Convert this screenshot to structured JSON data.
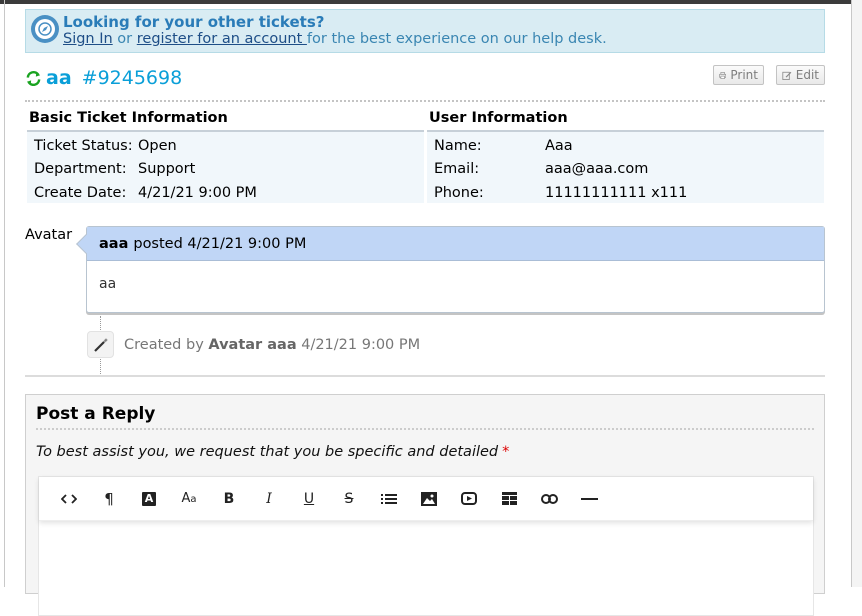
{
  "notice": {
    "title": "Looking for your other tickets?",
    "sign_in": "Sign In",
    "or_text": " or ",
    "register": "register for an account ",
    "rest": "for the best experience on our help desk."
  },
  "ticket": {
    "subject": "aa",
    "number": "#9245698",
    "print_label": "Print",
    "edit_label": "Edit"
  },
  "basic_info": {
    "heading": "Basic Ticket Information",
    "rows": [
      {
        "label": "Ticket Status:",
        "value": "Open"
      },
      {
        "label": "Department:",
        "value": "Support"
      },
      {
        "label": "Create Date:",
        "value": "4/21/21 9:00 PM"
      }
    ]
  },
  "user_info": {
    "heading": "User Information",
    "rows": [
      {
        "label": "Name:",
        "value": "Aaa"
      },
      {
        "label": "Email:",
        "value": "aaa@aaa.com"
      },
      {
        "label": "Phone:",
        "value": "11111111111 x111"
      }
    ]
  },
  "thread": {
    "avatar_label": "Avatar",
    "post": {
      "author": "aaa",
      "posted_text": "posted 4/21/21 9:00 PM",
      "body": "aa"
    },
    "event": {
      "prefix": "Created by ",
      "who": "Avatar aaa",
      "when": " 4/21/21 9:00 PM"
    }
  },
  "reply": {
    "title": "Post a Reply",
    "note": "To best assist you, we request that you be specific and detailed",
    "required_mark": "*",
    "toolbar": [
      {
        "name": "html-source-button",
        "glyph": "<>"
      },
      {
        "name": "paragraph-format-button",
        "glyph": "¶"
      },
      {
        "name": "text-color-button",
        "glyph": "A"
      },
      {
        "name": "font-size-button",
        "glyph": "Aa"
      },
      {
        "name": "bold-button",
        "glyph": "B"
      },
      {
        "name": "italic-button",
        "glyph": "I"
      },
      {
        "name": "underline-button",
        "glyph": "U"
      },
      {
        "name": "strikethrough-button",
        "glyph": "S"
      },
      {
        "name": "list-button",
        "glyph": "list"
      },
      {
        "name": "insert-image-button",
        "glyph": "image"
      },
      {
        "name": "insert-video-button",
        "glyph": "video"
      },
      {
        "name": "insert-table-button",
        "glyph": "table"
      },
      {
        "name": "insert-link-button",
        "glyph": "link"
      },
      {
        "name": "horizontal-rule-button",
        "glyph": "—"
      }
    ]
  },
  "colors": {
    "accent": "#0a9fd8",
    "notice_bg": "#d9ecf3",
    "post_header_bg": "#c0d6f6",
    "refresh_icon": "#1aa321"
  }
}
